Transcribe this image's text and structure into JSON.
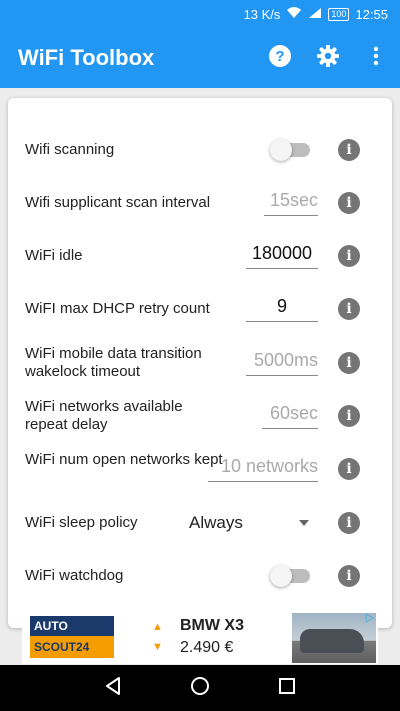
{
  "status_bar": {
    "speed": "13 K/s",
    "battery": "100",
    "time": "12:55"
  },
  "app_bar": {
    "title": "WiFi Toolbox",
    "icons": [
      "help-icon",
      "settings-gear-icon",
      "overflow-menu-icon"
    ]
  },
  "colors": {
    "primary": "#2196f3",
    "info_icon": "#757575",
    "hint_text": "#aaaaaa"
  },
  "settings": [
    {
      "label": "Wifi scanning",
      "control": "switch",
      "checked": false
    },
    {
      "label": "Wifi supplicant scan interval",
      "control": "text",
      "placeholder": "15sec"
    },
    {
      "label": "WiFi idle",
      "control": "text",
      "value": "180000"
    },
    {
      "label": "WiFI max DHCP retry count",
      "control": "text",
      "value": "9"
    },
    {
      "label": "WiFi mobile data transition wakelock timeout",
      "control": "text",
      "placeholder": "5000ms"
    },
    {
      "label": "WiFi networks available repeat delay",
      "control": "text",
      "placeholder": "60sec"
    },
    {
      "label": "WiFi num open networks kept",
      "control": "text",
      "placeholder": "10 networks"
    },
    {
      "label": "WiFi sleep policy",
      "control": "select",
      "value": "Always"
    },
    {
      "label": "WiFi watchdog",
      "control": "switch",
      "checked": false
    }
  ],
  "ad": {
    "logo_line1": "AUTO",
    "logo_line2": "SCOUT24",
    "title": "BMW X3",
    "price": "2.490 €"
  },
  "nav_bar": {
    "icons": [
      "back-icon",
      "home-icon",
      "recents-icon"
    ]
  }
}
